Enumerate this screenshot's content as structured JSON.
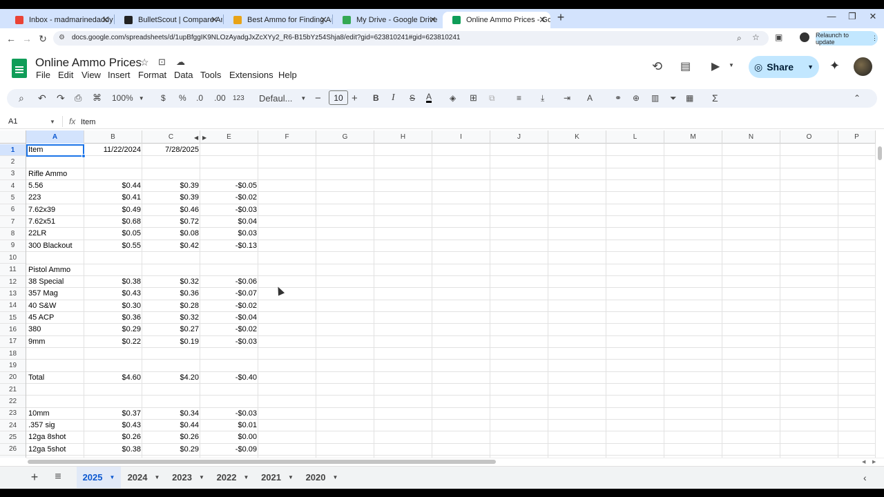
{
  "browser": {
    "tabs": [
      {
        "title": "Inbox - madmarinedaddy@gmail",
        "favicon_color": "#ea4335",
        "favicon": "gmail-icon"
      },
      {
        "title": "BulletScout | Compare Ammunition",
        "favicon_color": "#222222",
        "favicon": "bulletscout-icon"
      },
      {
        "title": "Best Ammo for Finding Ammunition",
        "favicon_color": "#e8a317",
        "favicon": "ammo-site-icon"
      },
      {
        "title": "My Drive - Google Drive",
        "favicon_color": "#34a853",
        "favicon": "google-drive-icon"
      },
      {
        "title": "Online Ammo Prices - Google Sheets",
        "favicon_color": "#0f9d58",
        "favicon": "google-sheets-icon"
      }
    ],
    "active_tab_index": 4,
    "url": "docs.google.com/spreadsheets/d/1upBfggIK9NLOzAyadgJxZcXYy2_R6-B15bYz54Shja8/edit?gid=623810241#gid=623810241",
    "relaunch_label": "Relaunch to update"
  },
  "app": {
    "doc_title": "Online Ammo Prices",
    "menus": [
      "File",
      "Edit",
      "View",
      "Insert",
      "Format",
      "Data",
      "Tools",
      "Extensions",
      "Help"
    ],
    "share_label": "Share",
    "brand_color": "#0f9d58",
    "accent_color": "#1a73e8"
  },
  "toolbar": {
    "zoom": "100%",
    "currency": "$",
    "percent": "%",
    "dec_decrease": ".0",
    "dec_increase": ".00",
    "number_format": "123",
    "font": "Defaul...",
    "font_size": "10",
    "bold": "B",
    "italic": "I",
    "sigma": "Σ"
  },
  "formula_bar": {
    "name_box": "A1",
    "fx": "fx",
    "content": "Item"
  },
  "grid": {
    "columns": [
      "A",
      "B",
      "C",
      "E",
      "F",
      "G",
      "H",
      "I",
      "J",
      "K",
      "L",
      "M",
      "N",
      "O",
      "P"
    ],
    "rows": [
      {
        "n": "1",
        "a": "Item",
        "b": "11/22/2024",
        "c": "7/28/2025",
        "e": ""
      },
      {
        "n": "2",
        "a": "",
        "b": "",
        "c": "",
        "e": ""
      },
      {
        "n": "3",
        "a": "Rifle Ammo",
        "b": "",
        "c": "",
        "e": ""
      },
      {
        "n": "4",
        "a": "5.56",
        "b": "$0.44",
        "c": "$0.39",
        "e": "-$0.05"
      },
      {
        "n": "5",
        "a": "223",
        "b": "$0.41",
        "c": "$0.39",
        "e": "-$0.02"
      },
      {
        "n": "6",
        "a": "7.62x39",
        "b": "$0.49",
        "c": "$0.46",
        "e": "-$0.03"
      },
      {
        "n": "7",
        "a": "7.62x51",
        "b": "$0.68",
        "c": "$0.72",
        "e": "$0.04"
      },
      {
        "n": "8",
        "a": "22LR",
        "b": "$0.05",
        "c": "$0.08",
        "e": "$0.03"
      },
      {
        "n": "9",
        "a": "300 Blackout",
        "b": "$0.55",
        "c": "$0.42",
        "e": "-$0.13"
      },
      {
        "n": "10",
        "a": "",
        "b": "",
        "c": "",
        "e": ""
      },
      {
        "n": "11",
        "a": "Pistol Ammo",
        "b": "",
        "c": "",
        "e": ""
      },
      {
        "n": "12",
        "a": "38 Special",
        "b": "$0.38",
        "c": "$0.32",
        "e": "-$0.06"
      },
      {
        "n": "13",
        "a": "357 Mag",
        "b": "$0.43",
        "c": "$0.36",
        "e": "-$0.07"
      },
      {
        "n": "14",
        "a": "40 S&W",
        "b": "$0.30",
        "c": "$0.28",
        "e": "-$0.02"
      },
      {
        "n": "15",
        "a": "45 ACP",
        "b": "$0.36",
        "c": "$0.32",
        "e": "-$0.04"
      },
      {
        "n": "16",
        "a": "380",
        "b": "$0.29",
        "c": "$0.27",
        "e": "-$0.02"
      },
      {
        "n": "17",
        "a": "9mm",
        "b": "$0.22",
        "c": "$0.19",
        "e": "-$0.03"
      },
      {
        "n": "18",
        "a": "",
        "b": "",
        "c": "",
        "e": ""
      },
      {
        "n": "19",
        "a": "",
        "b": "",
        "c": "",
        "e": ""
      },
      {
        "n": "20",
        "a": "Total",
        "b": "$4.60",
        "c": "$4.20",
        "e": "-$0.40"
      },
      {
        "n": "21",
        "a": "",
        "b": "",
        "c": "",
        "e": ""
      },
      {
        "n": "22",
        "a": "",
        "b": "",
        "c": "",
        "e": ""
      },
      {
        "n": "23",
        "a": "10mm",
        "b": "$0.37",
        "c": "$0.34",
        "e": "-$0.03"
      },
      {
        "n": "24",
        "a": ".357 sig",
        "b": "$0.43",
        "c": "$0.44",
        "e": "$0.01"
      },
      {
        "n": "25",
        "a": "12ga 8shot",
        "b": "$0.26",
        "c": "$0.26",
        "e": "$0.00"
      },
      {
        "n": "26",
        "a": "12ga 5shot",
        "b": "$0.38",
        "c": "$0.29",
        "e": "-$0.09"
      }
    ]
  },
  "sheets": {
    "tabs": [
      "2025",
      "2024",
      "2023",
      "2022",
      "2021",
      "2020"
    ],
    "active_index": 0
  }
}
